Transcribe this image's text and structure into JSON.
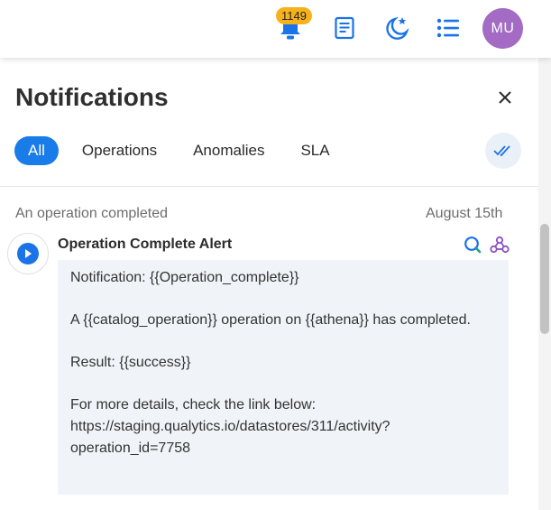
{
  "topbar": {
    "notification_count": "1149",
    "avatar_initials": "MU",
    "icons": [
      "bell-icon",
      "notes-icon",
      "moon-star-icon",
      "list-icon"
    ],
    "accent_color": "#1a73e8",
    "badge_color": "#f6b21a",
    "avatar_color": "#a36bc4"
  },
  "panel": {
    "title": "Notifications",
    "tabs": [
      {
        "label": "All",
        "active": true
      },
      {
        "label": "Operations",
        "active": false
      },
      {
        "label": "Anomalies",
        "active": false
      },
      {
        "label": "SLA",
        "active": false
      }
    ]
  },
  "notifications": [
    {
      "subject": "An operation completed",
      "date": "August 15th",
      "name": "Operation Complete Alert",
      "source_icons": [
        "qualytics-icon",
        "webhook-icon"
      ],
      "lines": [
        "Notification: {{Operation_complete}}",
        "A {{catalog_operation}} operation on {{athena}} has completed.",
        "Result: {{success}}",
        "For more details, check the link below: https://staging.qualytics.io/datastores/311/activity?operation_id=7758"
      ]
    }
  ]
}
